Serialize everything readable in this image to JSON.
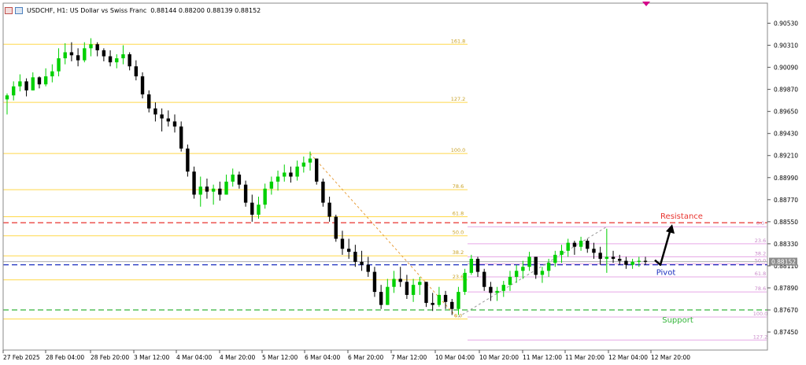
{
  "header": {
    "symbol": "USDCHF, H1: US Dollar vs Swiss Franc",
    "ohlc": "0.88144 0.88200 0.88139 0.88152"
  },
  "chart_data": {
    "type": "candlestick",
    "symbol": "USDCHF",
    "timeframe": "H1",
    "ylim": [
      0.8727,
      0.9073
    ],
    "y_ticks": [
      "0.90530",
      "0.90310",
      "0.90090",
      "0.89870",
      "0.89650",
      "0.89430",
      "0.89210",
      "0.88990",
      "0.88770",
      "0.88550",
      "0.88330",
      "0.88110",
      "0.87890",
      "0.87670",
      "0.87450"
    ],
    "x_ticks": [
      "27 Feb 2025",
      "28 Feb 04:00",
      "28 Feb 20:00",
      "3 Mar 12:00",
      "4 Mar 04:00",
      "4 Mar 20:00",
      "5 Mar 12:00",
      "6 Mar 04:00",
      "6 Mar 20:00",
      "7 Mar 12:00",
      "10 Mar 04:00",
      "10 Mar 20:00",
      "11 Mar 12:00",
      "11 Mar 20:00",
      "12 Mar 04:00",
      "12 Mar 20:00"
    ],
    "last_price": "0.88152",
    "price_path": [
      [
        0.8983,
        0.8962,
        0.8981
      ],
      [
        0.8995,
        0.8976,
        0.899
      ],
      [
        0.9002,
        0.8985,
        0.8995
      ],
      [
        0.8998,
        0.898,
        0.8986
      ],
      [
        0.9004,
        0.8988,
        0.8999
      ],
      [
        0.9,
        0.8988,
        0.8992
      ],
      [
        0.9008,
        0.899,
        0.9
      ],
      [
        0.9012,
        0.8994,
        0.9005
      ],
      [
        0.9028,
        0.9,
        0.9018
      ],
      [
        0.9033,
        0.9012,
        0.9024
      ],
      [
        0.9034,
        0.9015,
        0.9021
      ],
      [
        0.9028,
        0.901,
        0.9016
      ],
      [
        0.9034,
        0.9014,
        0.9028
      ],
      [
        0.9038,
        0.902,
        0.9032
      ],
      [
        0.9034,
        0.902,
        0.9026
      ],
      [
        0.9028,
        0.9015,
        0.902
      ],
      [
        0.9026,
        0.901,
        0.9014
      ],
      [
        0.9022,
        0.9008,
        0.9018
      ],
      [
        0.9031,
        0.9012,
        0.9022
      ],
      [
        0.9024,
        0.9006,
        0.901
      ],
      [
        0.9016,
        0.8996,
        0.9
      ],
      [
        0.9004,
        0.8978,
        0.8982
      ],
      [
        0.8986,
        0.8964,
        0.8968
      ],
      [
        0.8974,
        0.8955,
        0.8962
      ],
      [
        0.8968,
        0.8945,
        0.8958
      ],
      [
        0.8966,
        0.895,
        0.8955
      ],
      [
        0.8962,
        0.8944,
        0.895
      ],
      [
        0.8955,
        0.8925,
        0.8928
      ],
      [
        0.8932,
        0.89,
        0.8905
      ],
      [
        0.891,
        0.8878,
        0.8882
      ],
      [
        0.89,
        0.887,
        0.889
      ],
      [
        0.8898,
        0.8878,
        0.8885
      ],
      [
        0.8892,
        0.8872,
        0.8888
      ],
      [
        0.8895,
        0.8876,
        0.8882
      ],
      [
        0.8902,
        0.8884,
        0.8895
      ],
      [
        0.8908,
        0.889,
        0.8902
      ],
      [
        0.8905,
        0.8888,
        0.8892
      ],
      [
        0.8896,
        0.887,
        0.8874
      ],
      [
        0.8882,
        0.8855,
        0.8862
      ],
      [
        0.888,
        0.8858,
        0.8872
      ],
      [
        0.8893,
        0.8868,
        0.8888
      ],
      [
        0.89,
        0.8882,
        0.8895
      ],
      [
        0.8906,
        0.8886,
        0.89
      ],
      [
        0.8912,
        0.8895,
        0.8904
      ],
      [
        0.891,
        0.8894,
        0.89
      ],
      [
        0.8916,
        0.8896,
        0.891
      ],
      [
        0.892,
        0.8904,
        0.8914
      ],
      [
        0.8925,
        0.8906,
        0.8918
      ],
      [
        0.8914,
        0.8892,
        0.8895
      ],
      [
        0.8898,
        0.887,
        0.8874
      ],
      [
        0.888,
        0.8855,
        0.886
      ],
      [
        0.8862,
        0.8835,
        0.8838
      ],
      [
        0.8846,
        0.8822,
        0.8828
      ],
      [
        0.8838,
        0.8818,
        0.8825
      ],
      [
        0.8832,
        0.881,
        0.8815
      ],
      [
        0.8826,
        0.8806,
        0.8812
      ],
      [
        0.882,
        0.88,
        0.8805
      ],
      [
        0.881,
        0.878,
        0.8785
      ],
      [
        0.8792,
        0.8768,
        0.8772
      ],
      [
        0.8798,
        0.8772,
        0.879
      ],
      [
        0.8806,
        0.8784,
        0.8798
      ],
      [
        0.881,
        0.879,
        0.8795
      ],
      [
        0.8802,
        0.8778,
        0.8782
      ],
      [
        0.8798,
        0.8775,
        0.8792
      ],
      [
        0.88,
        0.8782,
        0.8795
      ],
      [
        0.879,
        0.877,
        0.8774
      ],
      [
        0.8784,
        0.8766,
        0.8772
      ],
      [
        0.879,
        0.877,
        0.8782
      ],
      [
        0.8786,
        0.8768,
        0.8775
      ],
      [
        0.8778,
        0.8762,
        0.8768
      ],
      [
        0.879,
        0.8762,
        0.8785
      ],
      [
        0.8808,
        0.8782,
        0.8804
      ],
      [
        0.8822,
        0.8802,
        0.8818
      ],
      [
        0.882,
        0.88,
        0.8805
      ],
      [
        0.8808,
        0.8786,
        0.879
      ],
      [
        0.8795,
        0.8776,
        0.8784
      ],
      [
        0.879,
        0.8776,
        0.8786
      ],
      [
        0.8796,
        0.878,
        0.8792
      ],
      [
        0.8806,
        0.8786,
        0.88
      ],
      [
        0.8812,
        0.8794,
        0.8806
      ],
      [
        0.8816,
        0.8798,
        0.881
      ],
      [
        0.8825,
        0.8806,
        0.882
      ],
      [
        0.882,
        0.8798,
        0.8802
      ],
      [
        0.881,
        0.8794,
        0.8806
      ],
      [
        0.8818,
        0.88,
        0.8814
      ],
      [
        0.8826,
        0.881,
        0.8822
      ],
      [
        0.8832,
        0.8814,
        0.8826
      ],
      [
        0.8838,
        0.882,
        0.8834
      ],
      [
        0.8836,
        0.8822,
        0.883
      ],
      [
        0.884,
        0.8826,
        0.8836
      ],
      [
        0.8838,
        0.8824,
        0.8828
      ],
      [
        0.8834,
        0.8818,
        0.8824
      ],
      [
        0.883,
        0.8812,
        0.8818
      ],
      [
        0.8848,
        0.8804,
        0.882
      ],
      [
        0.8826,
        0.8814,
        0.8818
      ],
      [
        0.8822,
        0.8812,
        0.8816
      ],
      [
        0.882,
        0.8808,
        0.8812
      ],
      [
        0.8818,
        0.8808,
        0.8815
      ],
      [
        0.882,
        0.881,
        0.8816
      ],
      [
        0.882,
        0.8812,
        0.8815
      ]
    ],
    "left_fib": {
      "color": "#ffd84a",
      "levels": [
        {
          "label": "161.8",
          "price": 0.9032
        },
        {
          "label": "127.2",
          "price": 0.8974
        },
        {
          "label": "100.0",
          "price": 0.8923
        },
        {
          "label": "78.6",
          "price": 0.8887
        },
        {
          "label": "61.8",
          "price": 0.886
        },
        {
          "label": "50.0",
          "price": 0.8841
        },
        {
          "label": "38.2",
          "price": 0.8821
        },
        {
          "label": "23.6",
          "price": 0.8797
        },
        {
          "label": "0.0",
          "price": 0.8758
        }
      ]
    },
    "right_fib": {
      "color": "#e6a8e6",
      "levels": [
        {
          "label": "0.0",
          "price": 0.885
        },
        {
          "label": "23.6",
          "price": 0.8833
        },
        {
          "label": "38.2",
          "price": 0.882
        },
        {
          "label": "50.0",
          "price": 0.8813
        },
        {
          "label": "61.8",
          "price": 0.88
        },
        {
          "label": "78.6",
          "price": 0.8785
        },
        {
          "label": "100.0",
          "price": 0.876
        },
        {
          "label": "127.2",
          "price": 0.8737
        }
      ]
    },
    "resistance": {
      "label": "Resistance",
      "price": 0.8854,
      "color": "#e8332e"
    },
    "pivot": {
      "label": "Pivot",
      "price": 0.8812,
      "color": "#1b2fbf"
    },
    "support": {
      "label": "Support",
      "price": 0.8767,
      "color": "#34b53a"
    },
    "colors": {
      "bull": "#00d000",
      "bear": "#000000",
      "axis": "#555555"
    }
  }
}
